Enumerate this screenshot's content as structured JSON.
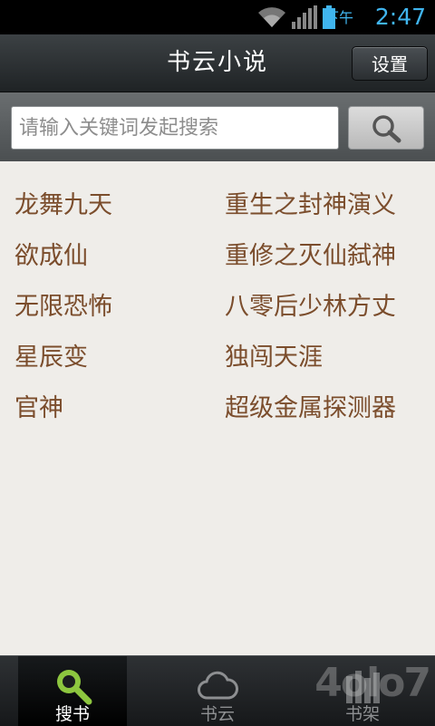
{
  "status_bar": {
    "ampm": "下午",
    "time": "2:47"
  },
  "header": {
    "title": "书云小说",
    "settings_label": "设置"
  },
  "search": {
    "placeholder": "请输入关键词发起搜索",
    "button_icon": "search-icon"
  },
  "books": {
    "left": [
      "龙舞九天",
      "欲成仙",
      "无限恐怖",
      "星辰变",
      "官神"
    ],
    "right": [
      "重生之封神演义",
      "重修之灭仙弑神",
      "八零后少林方丈",
      "独闯天涯",
      "超级金属探测器"
    ]
  },
  "tabs": [
    {
      "label": "搜书",
      "icon": "search-icon",
      "active": true
    },
    {
      "label": "书云",
      "icon": "cloud-icon",
      "active": false
    },
    {
      "label": "书架",
      "icon": "bookshelf-icon",
      "active": false
    }
  ],
  "watermark": "4olo7",
  "colors": {
    "book_text": "#7b4d2c",
    "active_tab_icon": "#8dc63f",
    "clock": "#40b5ef"
  }
}
